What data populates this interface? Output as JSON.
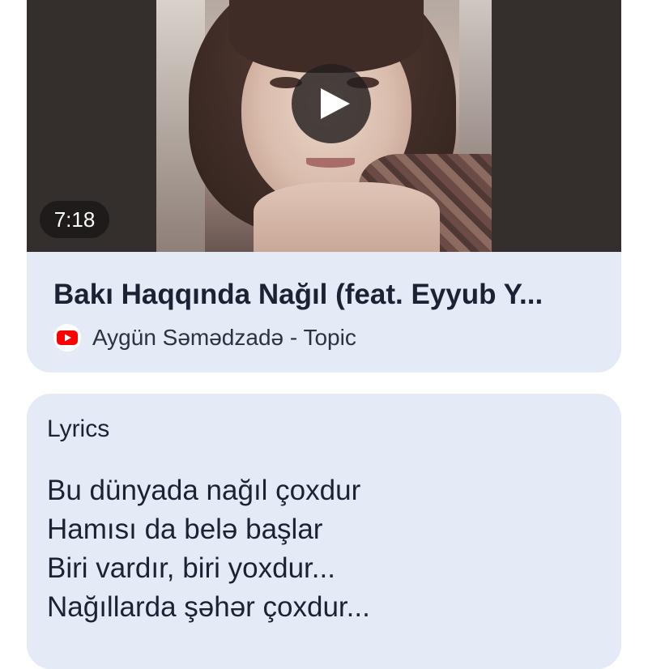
{
  "video": {
    "duration": "7:18",
    "title": "Bakı Haqqında Nağıl (feat. Eyyub Y...",
    "channel": "Aygün Səmədzadə - Topic",
    "play_icon": "play-icon",
    "channel_icon": "youtube-icon"
  },
  "lyrics": {
    "heading": "Lyrics",
    "lines": [
      "Bu dünyada nağıl çoxdur",
      "Hamısı da belə başlar",
      "Biri vardır, biri yoxdur...",
      "Nağıllarda şəhər çoxdur..."
    ]
  },
  "colors": {
    "card_background": "#e4eaf6",
    "thumbnail_background": "#342e2d",
    "text_primary": "#1a2233",
    "youtube_red": "#ff0000"
  }
}
